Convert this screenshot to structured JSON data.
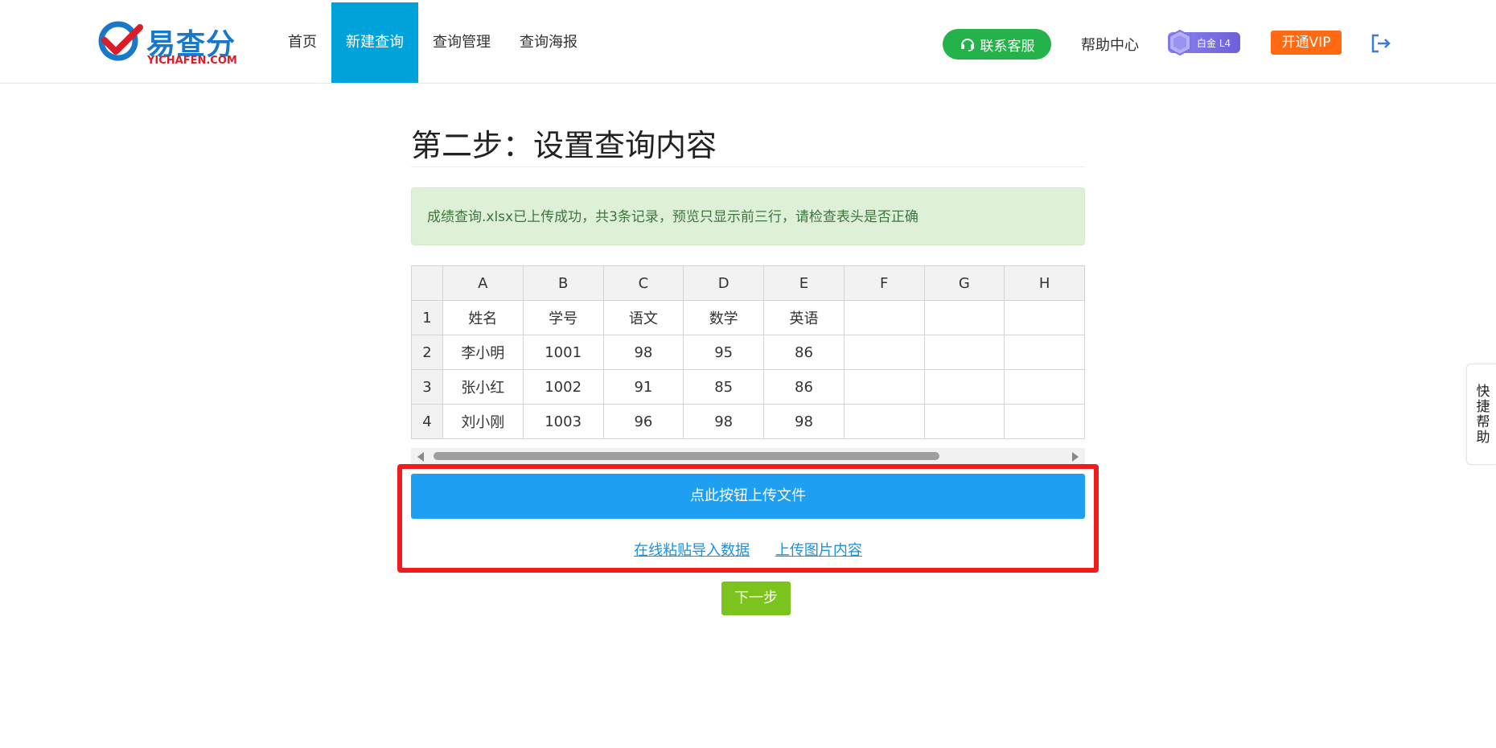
{
  "header": {
    "logo": {
      "text": "易查分",
      "sub": "YICHAFEN.COM"
    },
    "nav": [
      {
        "label": "首页",
        "active": false
      },
      {
        "label": "新建查询",
        "active": true
      },
      {
        "label": "查询管理",
        "active": false
      },
      {
        "label": "查询海报",
        "active": false
      }
    ],
    "service_label": "联系客服",
    "help_label": "帮助中心",
    "badge_label": "白金 L4",
    "vip_label": "开通VIP",
    "icons": {
      "service": "headset-icon",
      "badge": "gem-icon",
      "logout": "logout-icon"
    }
  },
  "main": {
    "title": "第二步：设置查询内容",
    "alert": "成绩查询.xlsx已上传成功，共3条记录，预览只显示前三行，请检查表头是否正确",
    "sheet": {
      "columns": [
        "A",
        "B",
        "C",
        "D",
        "E",
        "F",
        "G",
        "H"
      ],
      "rows": [
        {
          "num": "1",
          "cells": [
            "姓名",
            "学号",
            "语文",
            "数学",
            "英语",
            "",
            "",
            ""
          ]
        },
        {
          "num": "2",
          "cells": [
            "李小明",
            "1001",
            "98",
            "95",
            "86",
            "",
            "",
            ""
          ]
        },
        {
          "num": "3",
          "cells": [
            "张小红",
            "1002",
            "91",
            "85",
            "86",
            "",
            "",
            ""
          ]
        },
        {
          "num": "4",
          "cells": [
            "刘小刚",
            "1003",
            "96",
            "98",
            "98",
            "",
            "",
            ""
          ]
        }
      ]
    },
    "upload_label": "点此按钮上传文件",
    "paste_label": "在线粘贴导入数据",
    "image_label": "上传图片内容",
    "next_label": "下一步"
  },
  "sidebar": {
    "quick_help": "快捷帮助"
  },
  "colors": {
    "nav_active": "#00a3d9",
    "service_green": "#24b24a",
    "vip_orange": "#ff6a13",
    "upload_blue": "#1e9ff2",
    "next_green": "#7dc31e",
    "highlight_red": "#ee1c1c"
  }
}
